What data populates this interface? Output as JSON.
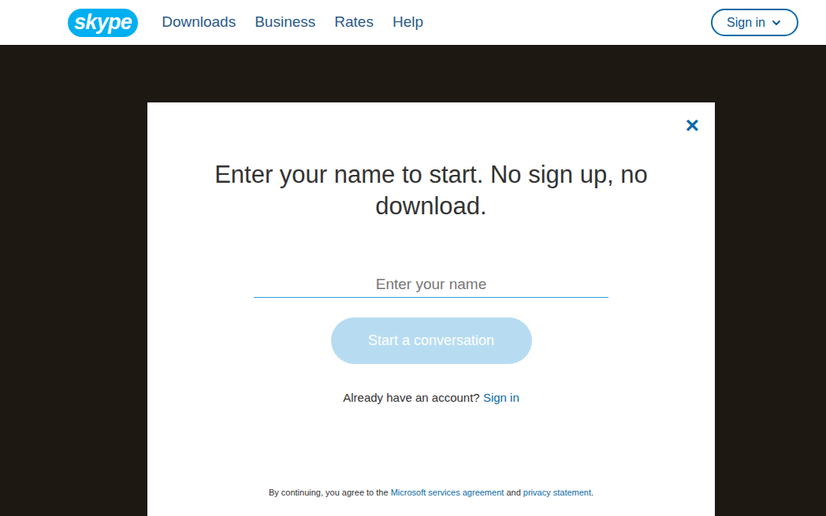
{
  "nav": {
    "logo": "skype",
    "links": [
      "Downloads",
      "Business",
      "Rates",
      "Help"
    ],
    "sign_in": "Sign in"
  },
  "dialog": {
    "close": "×",
    "heading": "Enter your name to start. No sign up, no download.",
    "input": {
      "placeholder": "Enter your name",
      "value": ""
    },
    "button": {
      "label": "Start a conversation",
      "disabled": true
    },
    "account_prompt": "Already have an account?",
    "account_link": "Sign in",
    "legal": {
      "prefix": "By continuing, you agree to the",
      "agreement": "Microsoft services agreement",
      "and": "and",
      "privacy": "privacy statement",
      "suffix": "."
    }
  }
}
